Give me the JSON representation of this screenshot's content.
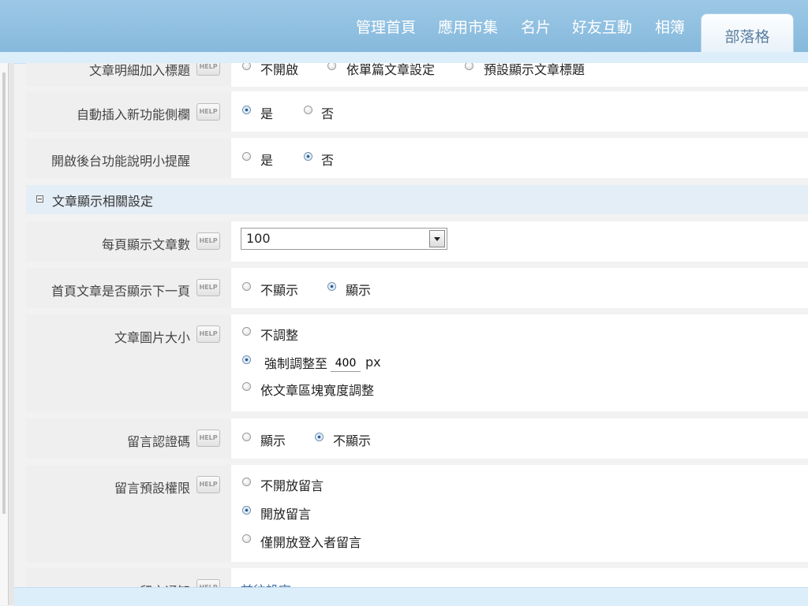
{
  "nav": {
    "items": [
      {
        "label": "管理首頁"
      },
      {
        "label": "應用市集"
      },
      {
        "label": "名片"
      },
      {
        "label": "好友互動"
      },
      {
        "label": "相簿"
      }
    ],
    "active_tab": "部落格"
  },
  "settings": {
    "row0": {
      "label": "文章明細加入標題",
      "options": [
        "不開啟",
        "依單篇文章設定",
        "預設顯示文章標題"
      ]
    },
    "row1": {
      "label": "自動插入新功能側欄",
      "options": [
        "是",
        "否"
      ],
      "selected": "是"
    },
    "row2": {
      "label": "開啟後台功能說明小提醒",
      "options": [
        "是",
        "否"
      ],
      "selected": "否"
    },
    "section_title": "文章顯示相關設定",
    "per_page": {
      "label": "每頁顯示文章數",
      "value": "100"
    },
    "next_page": {
      "label": "首頁文章是否顯示下一頁",
      "options": [
        "不顯示",
        "顯示"
      ],
      "selected": "顯示"
    },
    "image_size": {
      "label": "文章圖片大小",
      "options": [
        "不調整",
        "強制調整至",
        "依文章區塊寬度調整"
      ],
      "selected": "強制調整至",
      "px_value": "400",
      "px_unit": "px"
    },
    "captcha": {
      "label": "留言認證碼",
      "options": [
        "顯示",
        "不顯示"
      ],
      "selected": "不顯示"
    },
    "comment_perm": {
      "label": "留言預設權限",
      "options": [
        "不開放留言",
        "開放留言",
        "僅開放登入者留言"
      ],
      "selected": "開放留言"
    },
    "comment_notify": {
      "label": "留言通知",
      "link": "前往設定"
    },
    "help_label": "HELP"
  }
}
